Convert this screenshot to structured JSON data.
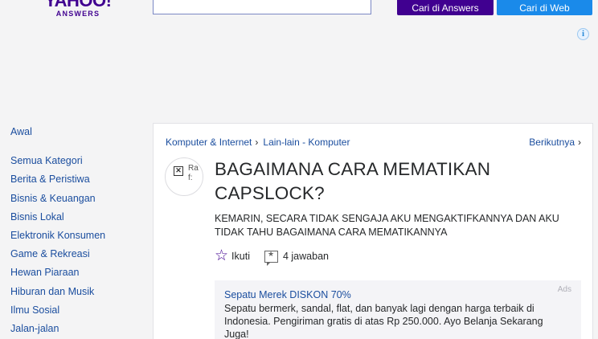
{
  "header": {
    "logo_main": "YAHOO!",
    "logo_sub": "ANSWERS",
    "search_value": "",
    "search_answers_label": "Cari di Answers",
    "search_web_label": "Cari di Web"
  },
  "ad_choices_icon": "info-icon",
  "sidebar": {
    "items": [
      {
        "label": "Awal"
      },
      {
        "label": "Semua Kategori"
      },
      {
        "label": "Berita & Peristiwa"
      },
      {
        "label": "Bisnis & Keuangan"
      },
      {
        "label": "Bisnis Lokal"
      },
      {
        "label": "Elektronik Konsumen"
      },
      {
        "label": "Game & Rekreasi"
      },
      {
        "label": "Hewan Piaraan"
      },
      {
        "label": "Hiburan dan Musik"
      },
      {
        "label": "Ilmu Sosial"
      },
      {
        "label": "Jalan-jalan"
      }
    ]
  },
  "breadcrumb": {
    "items": [
      "Komputer & Internet",
      "Lain-lain - Komputer"
    ],
    "separator": "›",
    "next_label": "Berikutnya"
  },
  "question": {
    "avatar_alt": "Raf:",
    "title": "BAGAIMANA CARA MEMATIKAN CAPSLOCK?",
    "body": "KEMARIN, SECARA TIDAK SENGAJA AKU MENGAKTIFKANNYA DAN AKU TIDAK TAHU BAGAIMANA CARA MEMATIKANNYA",
    "follow_label": "Ikuti",
    "answers_label": "4 jawaban"
  },
  "ad": {
    "label": "Ads",
    "title": "Sepatu Merek DISKON 70%",
    "text": "Sepatu bermerk, sandal, flat, dan banyak lagi dengan harga terbaik di Indonesia. Pengiriman gratis di atas Rp 250.000. Ayo Belanja Sekarang Juga!"
  },
  "colors": {
    "brand_purple": "#400090",
    "web_blue": "#1a8aea",
    "link_blue": "#1a4d9e"
  }
}
